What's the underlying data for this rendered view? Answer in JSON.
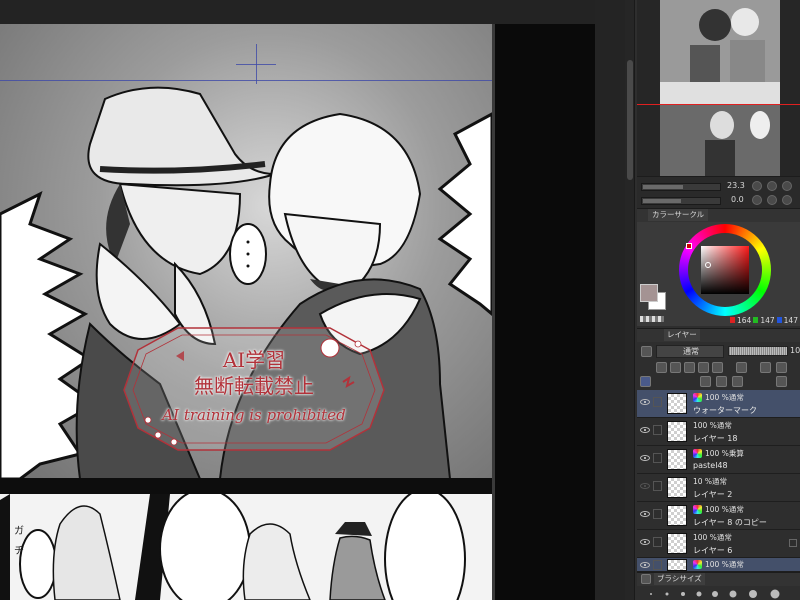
{
  "canvas": {
    "watermark": {
      "line1": "AI学習",
      "line2": "無断転載禁止",
      "line3": "AI training is prohibited",
      "color": "#b2323a"
    },
    "sfx_left": "ガ\nチ"
  },
  "navigator": {
    "zoom": "23.3",
    "rotation": "0.0"
  },
  "color_circle": {
    "tab_label": "カラーサークル",
    "main_color": "#a49393",
    "sub_color": "#ffffff",
    "r": "164",
    "g": "147",
    "b": "147"
  },
  "layers": {
    "tab_label": "レイヤー",
    "blend_mode": "通常",
    "opacity": "10",
    "items": [
      {
        "mode": "100 %通常",
        "name": "ウォーターマーク",
        "selected": true,
        "visible": true
      },
      {
        "mode": "100 %通常",
        "name": "レイヤー 18",
        "selected": false,
        "visible": true
      },
      {
        "mode": "100 %乗算",
        "name": "pastel48",
        "selected": false,
        "visible": true
      },
      {
        "mode": "10 %通常",
        "name": "レイヤー 2",
        "selected": false,
        "visible": false
      },
      {
        "mode": "100 %通常",
        "name": "レイヤー 8 のコピー",
        "selected": false,
        "visible": true
      },
      {
        "mode": "100 %通常",
        "name": "レイヤー 6",
        "selected": false,
        "visible": true
      },
      {
        "mode": "100 %通常",
        "name": "",
        "selected": true,
        "visible": true
      }
    ]
  },
  "brush_size": {
    "tab_label": "ブラシサイズ"
  }
}
